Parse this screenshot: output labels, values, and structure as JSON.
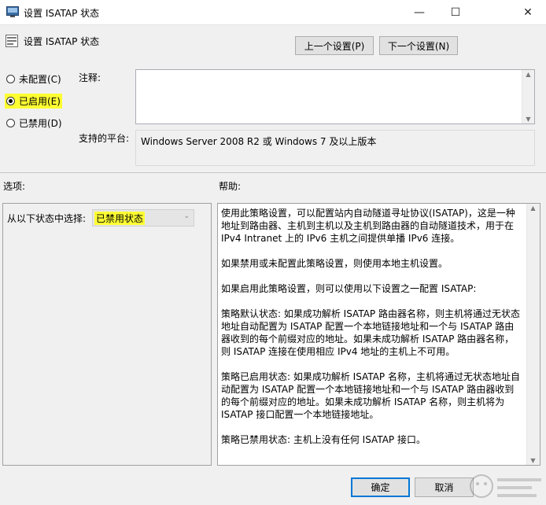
{
  "window": {
    "title": "设置 ISATAP 状态",
    "controls": {
      "minimize": "—",
      "maximize": "☐",
      "close": "✕"
    }
  },
  "header": {
    "policy_title": "设置 ISATAP 状态",
    "prev_button": "上一个设置(P)",
    "next_button": "下一个设置(N)"
  },
  "state_options": [
    {
      "label": "未配置(C)",
      "checked": false
    },
    {
      "label": "已启用(E)",
      "checked": true
    },
    {
      "label": "已禁用(D)",
      "checked": false
    }
  ],
  "comment": {
    "label": "注释:",
    "value": ""
  },
  "platform": {
    "label": "支持的平台:",
    "value": "Windows Server 2008 R2 或 Windows 7 及以上版本"
  },
  "options": {
    "section_label": "选项:",
    "select_label": "从以下状态中选择:",
    "select_value": "已禁用状态"
  },
  "help": {
    "section_label": "帮助:",
    "paragraphs": [
      "使用此策略设置，可以配置站内自动隧道寻址协议(ISATAP)，这是一种地址到路由器、主机到主机以及主机到路由器的自动隧道技术，用于在 IPv4 Intranet 上的 IPv6 主机之间提供单播 IPv6 连接。",
      "如果禁用或未配置此策略设置，则使用本地主机设置。",
      "如果启用此策略设置，则可以使用以下设置之一配置 ISATAP:",
      "策略默认状态: 如果成功解析 ISATAP 路由器名称，则主机将通过无状态地址自动配置为 ISATAP 配置一个本地链接地址和一个与 ISATAP 路由器收到的每个前缀对应的地址。如果未成功解析 ISATAP 路由器名称，则 ISATAP 连接在使用相应 IPv4 地址的主机上不可用。",
      "策略已启用状态: 如果成功解析 ISATAP 名称，主机将通过无状态地址自动配置为 ISATAP 配置一个本地链接地址和一个与 ISATAP 路由器收到的每个前缀对应的地址。如果未成功解析 ISATAP 名称，则主机将为 ISATAP 接口配置一个本地链接地址。",
      "策略已禁用状态: 主机上没有任何 ISATAP 接口。"
    ]
  },
  "footer": {
    "ok_button": "确定",
    "cancel_button": "取消"
  },
  "colors": {
    "highlight": "#ffff33",
    "accent": "#0078d7",
    "background": "#f0f0f0"
  }
}
